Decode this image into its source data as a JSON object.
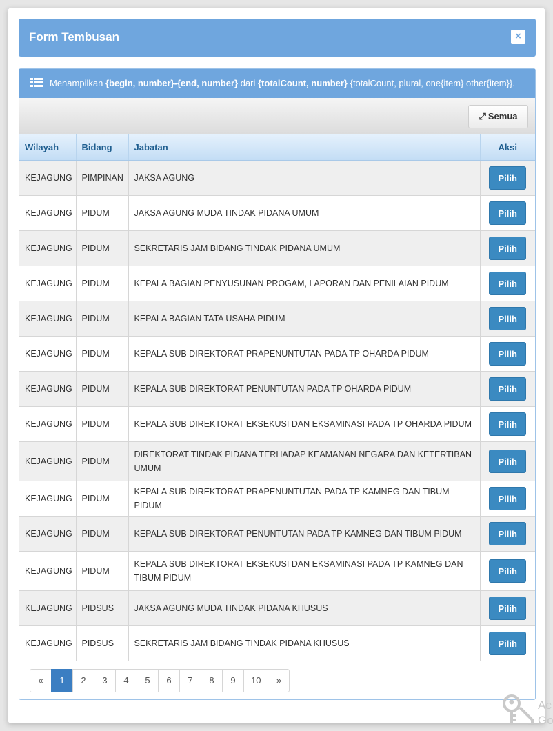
{
  "modal": {
    "title": "Form Tembusan",
    "close_label": "×"
  },
  "panel": {
    "summary_prefix": "Menampilkan ",
    "summary_begin_end": "{begin, number}-{end, number}",
    "summary_middle": " dari ",
    "summary_total": "{totalCount, number}",
    "summary_suffix": " {totalCount, plural, one{item} other{item}}."
  },
  "toolbar": {
    "semua_label": "Semua",
    "semua_icon": "expand-icon"
  },
  "table": {
    "headers": {
      "wilayah": "Wilayah",
      "bidang": "Bidang",
      "jabatan": "Jabatan",
      "aksi": "Aksi"
    },
    "action_label": "Pilih",
    "rows": [
      {
        "wilayah": "KEJAGUNG",
        "bidang": "PIMPINAN",
        "jabatan": "JAKSA AGUNG"
      },
      {
        "wilayah": "KEJAGUNG",
        "bidang": "PIDUM",
        "jabatan": "JAKSA AGUNG MUDA TINDAK PIDANA UMUM"
      },
      {
        "wilayah": "KEJAGUNG",
        "bidang": "PIDUM",
        "jabatan": "SEKRETARIS JAM BIDANG TINDAK PIDANA UMUM"
      },
      {
        "wilayah": "KEJAGUNG",
        "bidang": "PIDUM",
        "jabatan": "KEPALA BAGIAN PENYUSUNAN PROGAM, LAPORAN DAN PENILAIAN PIDUM"
      },
      {
        "wilayah": "KEJAGUNG",
        "bidang": "PIDUM",
        "jabatan": "KEPALA BAGIAN TATA USAHA PIDUM"
      },
      {
        "wilayah": "KEJAGUNG",
        "bidang": "PIDUM",
        "jabatan": "KEPALA SUB DIREKTORAT PRAPENUNTUTAN PADA TP OHARDA PIDUM"
      },
      {
        "wilayah": "KEJAGUNG",
        "bidang": "PIDUM",
        "jabatan": "KEPALA SUB DIREKTORAT PENUNTUTAN PADA TP OHARDA PIDUM"
      },
      {
        "wilayah": "KEJAGUNG",
        "bidang": "PIDUM",
        "jabatan": "KEPALA SUB DIREKTORAT EKSEKUSI DAN EKSAMINASI PADA TP OHARDA PIDUM"
      },
      {
        "wilayah": "KEJAGUNG",
        "bidang": "PIDUM",
        "jabatan": "DIREKTORAT TINDAK PIDANA TERHADAP KEAMANAN NEGARA DAN KETERTIBAN UMUM"
      },
      {
        "wilayah": "KEJAGUNG",
        "bidang": "PIDUM",
        "jabatan": "KEPALA SUB DIREKTORAT PRAPENUNTUTAN PADA TP KAMNEG DAN TIBUM PIDUM"
      },
      {
        "wilayah": "KEJAGUNG",
        "bidang": "PIDUM",
        "jabatan": "KEPALA SUB DIREKTORAT PENUNTUTAN PADA TP KAMNEG DAN TIBUM PIDUM"
      },
      {
        "wilayah": "KEJAGUNG",
        "bidang": "PIDUM",
        "jabatan": "KEPALA SUB DIREKTORAT EKSEKUSI DAN EKSAMINASI PADA TP KAMNEG DAN TIBUM PIDUM"
      },
      {
        "wilayah": "KEJAGUNG",
        "bidang": "PIDSUS",
        "jabatan": "JAKSA AGUNG MUDA TINDAK PIDANA KHUSUS"
      },
      {
        "wilayah": "KEJAGUNG",
        "bidang": "PIDSUS",
        "jabatan": "SEKRETARIS JAM BIDANG TINDAK PIDANA KHUSUS"
      }
    ]
  },
  "pagination": {
    "prev": "«",
    "pages": [
      "1",
      "2",
      "3",
      "4",
      "5",
      "6",
      "7",
      "8",
      "9",
      "10"
    ],
    "next": "»",
    "active_page": "1"
  },
  "watermark": {
    "line1": "Ac",
    "line2": "Go"
  },
  "colors": {
    "header_blue": "#6fa6de",
    "button_blue": "#3b8ac1",
    "active_page": "#3b7ec2"
  }
}
